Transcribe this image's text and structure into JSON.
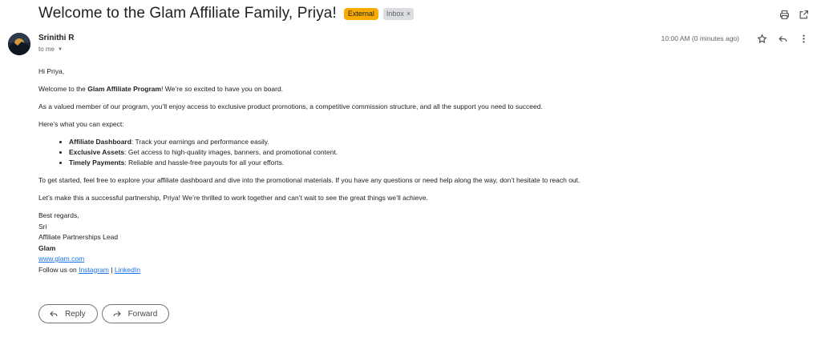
{
  "email": {
    "subject": "Welcome to the Glam Affiliate Family, Priya!",
    "labels": {
      "external": "External",
      "inbox": "Inbox",
      "remove": "×"
    },
    "sender": {
      "name": "Srinithi R",
      "recipient": "to me",
      "timestamp": "10:00 AM (0 minutes ago)"
    }
  },
  "body": {
    "greeting": "Hi Priya,",
    "intro_before": "Welcome to the ",
    "intro_bold": "Glam Affiliate Program",
    "intro_after": "! We’re so excited to have you on board.",
    "paragraph_member": "As a valued member of our program, you’ll enjoy access to exclusive product promotions, a competitive commission structure, and all the support you need to succeed.",
    "expect_heading": "Here’s what you can expect:",
    "benefits": [
      {
        "title": "Affiliate Dashboard",
        "text": ": Track your earnings and performance easily."
      },
      {
        "title": "Exclusive Assets",
        "text": ": Get access to high-quality images, banners, and promotional content."
      },
      {
        "title": "Timely Payments",
        "text": ": Reliable and hassle-free payouts for all your efforts."
      }
    ],
    "paragraph_start": "To get started, feel free to explore your affiliate dashboard and dive into the promotional materials. If you have any questions or need help along the way, don’t hesitate to reach out.",
    "paragraph_closing": "Let’s make this a successful partnership, Priya! We’re thrilled to work together and can’t wait to see the great things we’ll achieve."
  },
  "signature": {
    "sign_off": "Best regards,",
    "name": "Sri",
    "role": "Affiliate Partnerships Lead",
    "company": "Glam",
    "website": "www.glam.com",
    "follow_prefix": "Follow us on ",
    "instagram": "Instagram",
    "separator": " | ",
    "linkedin": "LinkedIn"
  },
  "actions": {
    "reply": "Reply",
    "forward": "Forward"
  },
  "icons": [
    "print-icon",
    "open-in-new-window-icon",
    "star-icon",
    "reply-icon",
    "more-vert-icon",
    "caret-down-icon",
    "forward-icon"
  ],
  "colors": {
    "external_badge": "#f9ab00",
    "inbox_badge": "#dadce0",
    "link": "#1a73e8"
  }
}
